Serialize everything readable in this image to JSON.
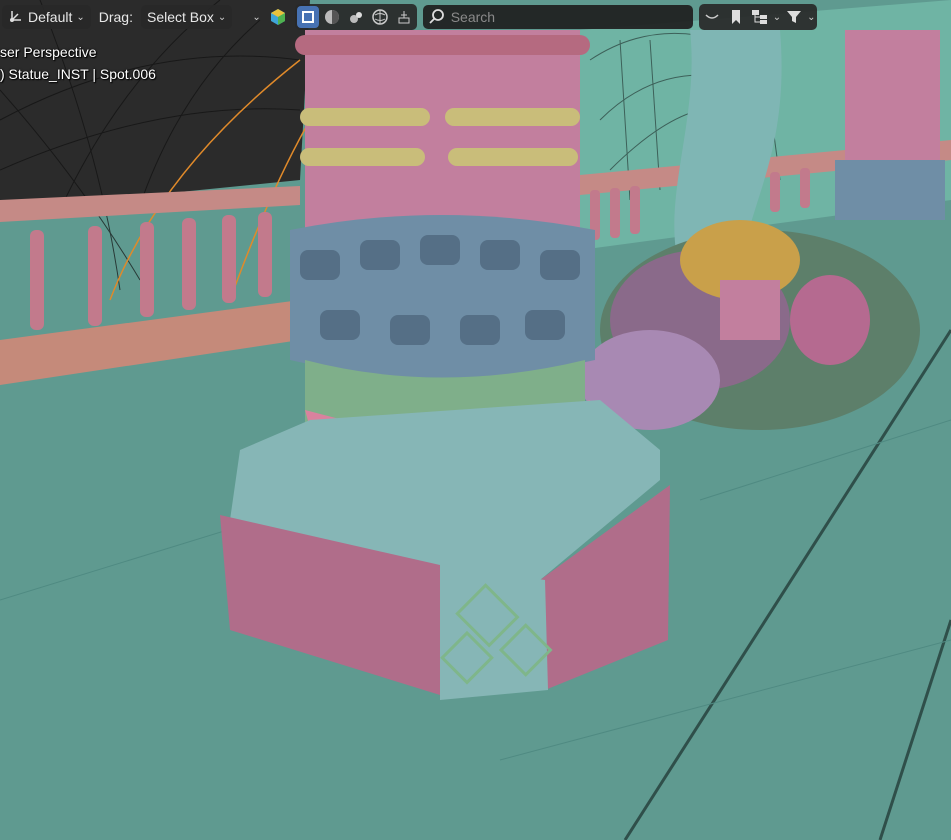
{
  "header": {
    "orientation": "Default",
    "drag_label": "Drag:",
    "drag_mode": "Select Box",
    "search_placeholder": "Search"
  },
  "overlay": {
    "view_name": "ser Perspective",
    "object_info": ") Statue_INST | Spot.006"
  },
  "icons": {
    "orientation": "transform-orientation-icon",
    "overlay": "viewport-overlays-icon",
    "solid": "solid-shading-icon",
    "material": "material-preview-icon",
    "rendered": "rendered-shading-icon",
    "search": "search-icon",
    "filter": "filter-icon",
    "bookmark": "bookmark-icon",
    "hierarchy": "hierarchy-icon"
  },
  "colors": {
    "floor": "#5f9a90",
    "pillar_pink": "#c27f9e",
    "ornament_blue": "#6f8ea6",
    "ornament_green": "#7faf8a",
    "base_cyan": "#86b6b6",
    "base_panel_pink": "#b06d8a",
    "railing": "#c58a86",
    "active_blue": "#4772b3"
  }
}
